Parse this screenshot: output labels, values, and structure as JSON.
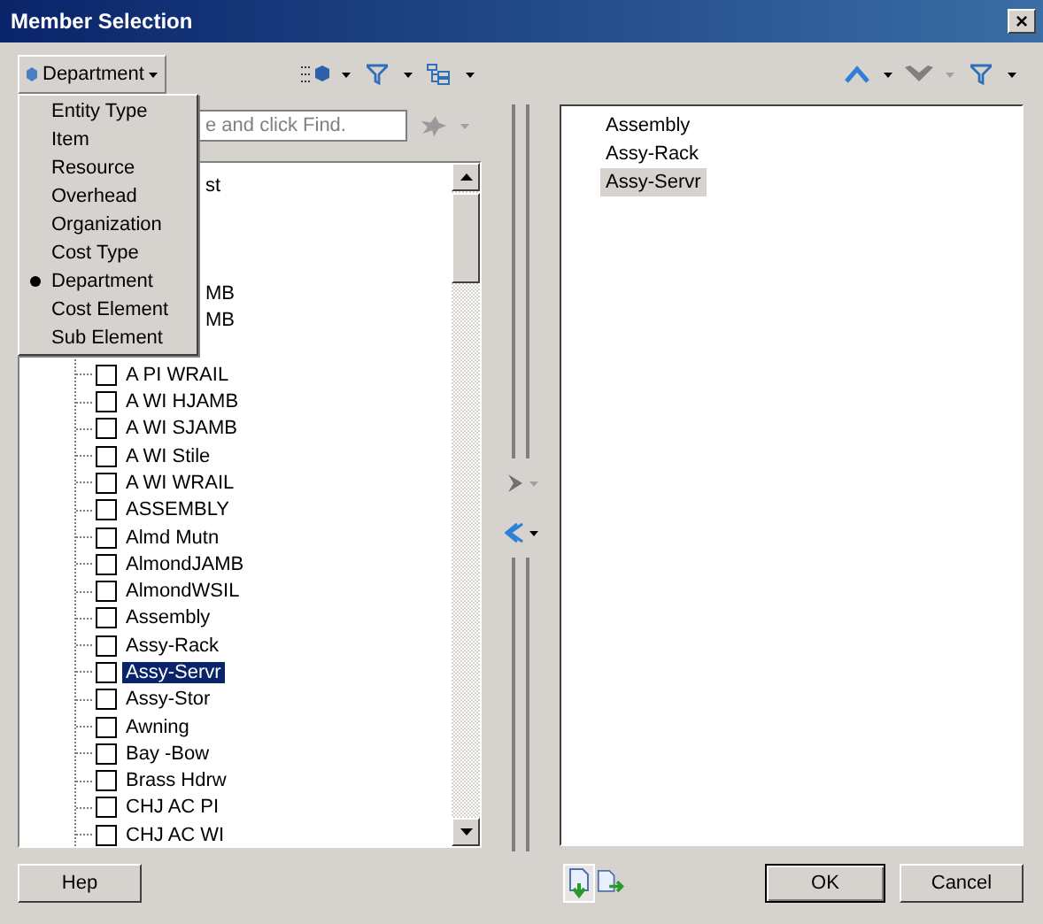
{
  "window": {
    "title": "Member Selection",
    "close": "×"
  },
  "dimension_button": {
    "label": "Department"
  },
  "dimension_menu": [
    {
      "label": "Entity Type",
      "selected": false
    },
    {
      "label": "Item",
      "selected": false
    },
    {
      "label": "Resource",
      "selected": false
    },
    {
      "label": "Overhead",
      "selected": false
    },
    {
      "label": "Organization",
      "selected": false
    },
    {
      "label": "Cost Type",
      "selected": false
    },
    {
      "label": "Department",
      "selected": true
    },
    {
      "label": "Cost Element",
      "selected": false
    },
    {
      "label": "Sub Element",
      "selected": false
    }
  ],
  "search": {
    "placeholder": "e and click Find."
  },
  "tree": [
    {
      "kind": "covered",
      "label": "st"
    },
    {
      "kind": "covered"
    },
    {
      "kind": "covered"
    },
    {
      "kind": "covered"
    },
    {
      "kind": "covered",
      "label": "MB"
    },
    {
      "kind": "covered",
      "label": "MB"
    },
    {
      "kind": "covered"
    },
    {
      "kind": "member",
      "label": "A PI WRAIL",
      "checked": false,
      "selected": false
    },
    {
      "kind": "member",
      "label": "A WI HJAMB",
      "checked": false,
      "selected": false
    },
    {
      "kind": "member",
      "label": "A WI SJAMB",
      "checked": false,
      "selected": false
    },
    {
      "kind": "member",
      "label": "A WI Stile",
      "checked": false,
      "selected": false
    },
    {
      "kind": "member",
      "label": "A WI WRAIL",
      "checked": false,
      "selected": false
    },
    {
      "kind": "member",
      "label": "ASSEMBLY",
      "checked": false,
      "selected": false
    },
    {
      "kind": "member",
      "label": "Almd Mutn",
      "checked": false,
      "selected": false
    },
    {
      "kind": "member",
      "label": "AlmondJAMB",
      "checked": false,
      "selected": false
    },
    {
      "kind": "member",
      "label": "AlmondWSIL",
      "checked": false,
      "selected": false
    },
    {
      "kind": "member",
      "label": "Assembly",
      "checked": false,
      "selected": false
    },
    {
      "kind": "member",
      "label": "Assy-Rack",
      "checked": false,
      "selected": false
    },
    {
      "kind": "member",
      "label": "Assy-Servr",
      "checked": false,
      "selected": true
    },
    {
      "kind": "member",
      "label": "Assy-Stor",
      "checked": false,
      "selected": false
    },
    {
      "kind": "member",
      "label": "Awning",
      "checked": false,
      "selected": false
    },
    {
      "kind": "member",
      "label": "Bay -Bow",
      "checked": false,
      "selected": false
    },
    {
      "kind": "member",
      "label": "Brass Hdrw",
      "checked": false,
      "selected": false
    },
    {
      "kind": "member",
      "label": "CHJ AC PI",
      "checked": false,
      "selected": false
    },
    {
      "kind": "member",
      "label": "CHJ AC WI",
      "checked": false,
      "selected": false
    }
  ],
  "selection": [
    {
      "label": "Assembly",
      "selected": false
    },
    {
      "label": "Assy-Rack",
      "selected": false
    },
    {
      "label": "Assy-Servr",
      "selected": true
    }
  ],
  "buttons": {
    "help": "Hep",
    "ok": "OK",
    "cancel": "Cancel"
  }
}
